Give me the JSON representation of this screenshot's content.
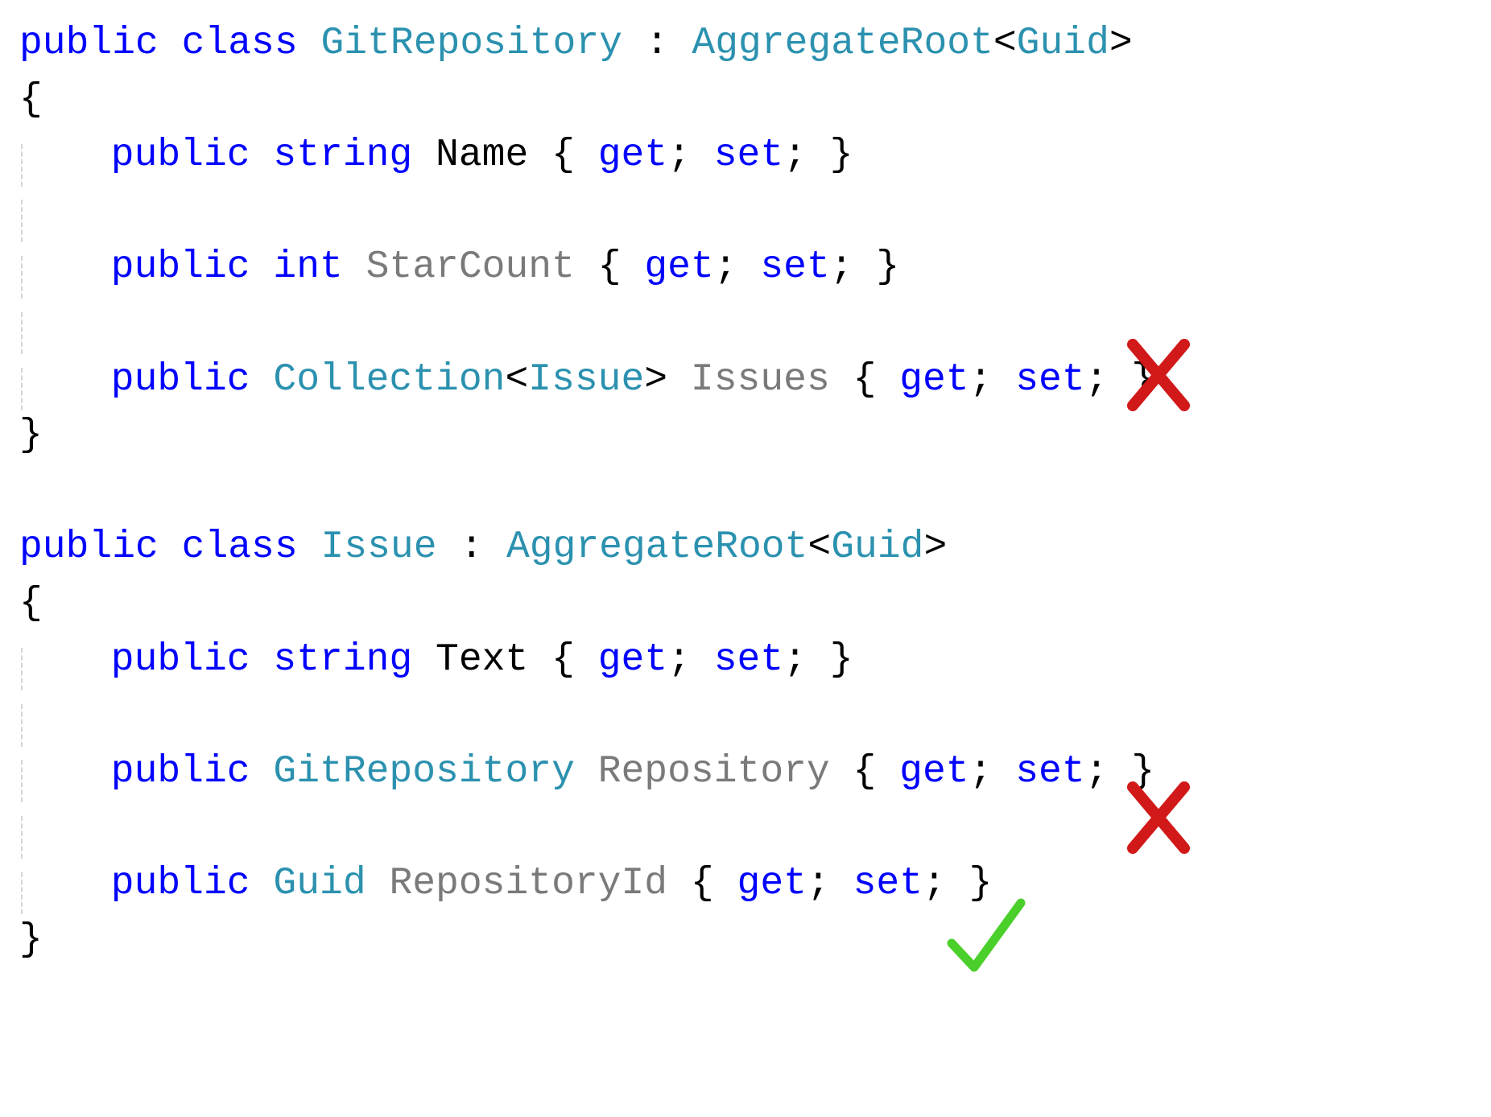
{
  "code": {
    "class1": {
      "decl_public": "public",
      "decl_class": "class",
      "name": "GitRepository",
      "colon": ":",
      "base": "AggregateRoot",
      "lt": "<",
      "base_param": "Guid",
      "gt": ">",
      "open_brace": "{",
      "close_brace": "}",
      "prop1": {
        "public": "public",
        "type": "string",
        "name": "Name",
        "body_open": "{",
        "get": "get",
        "semi1": ";",
        "set": "set",
        "semi2": ";",
        "body_close": "}"
      },
      "prop2": {
        "public": "public",
        "type": "int",
        "name": "StarCount",
        "body_open": "{",
        "get": "get",
        "semi1": ";",
        "set": "set",
        "semi2": ";",
        "body_close": "}"
      },
      "prop3": {
        "public": "public",
        "type_outer": "Collection",
        "lt": "<",
        "type_inner": "Issue",
        "gt": ">",
        "name": "Issues",
        "body_open": "{",
        "get": "get",
        "semi1": ";",
        "set": "set",
        "semi2": ";",
        "body_close": "}"
      }
    },
    "class2": {
      "decl_public": "public",
      "decl_class": "class",
      "name": "Issue",
      "colon": ":",
      "base": "AggregateRoot",
      "lt": "<",
      "base_param": "Guid",
      "gt": ">",
      "open_brace": "{",
      "close_brace": "}",
      "prop1": {
        "public": "public",
        "type": "string",
        "name": "Text",
        "body_open": "{",
        "get": "get",
        "semi1": ";",
        "set": "set",
        "semi2": ";",
        "body_close": "}"
      },
      "prop2": {
        "public": "public",
        "type": "GitRepository",
        "name": "Repository",
        "body_open": "{",
        "get": "get",
        "semi1": ";",
        "set": "set",
        "semi2": ";",
        "body_close": "}"
      },
      "prop3": {
        "public": "public",
        "type": "Guid",
        "name": "RepositoryId",
        "body_open": "{",
        "get": "get",
        "semi1": ";",
        "set": "set",
        "semi2": ";",
        "body_close": "}"
      }
    }
  },
  "marks": {
    "cross1": "cross-icon",
    "cross2": "cross-icon",
    "check1": "check-icon"
  }
}
